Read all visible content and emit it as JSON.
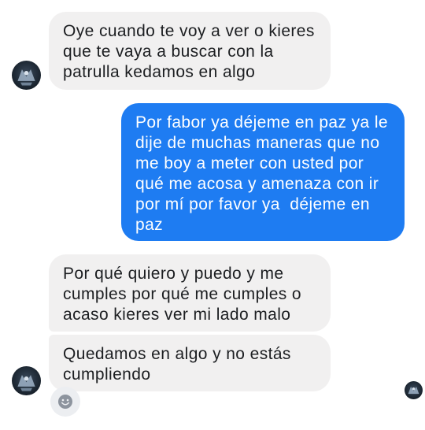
{
  "messages": [
    {
      "direction": "incoming",
      "text": "Oye cuando te voy a ver o kieres\nque te vaya a buscar con la\npatrulla kedamos en algo"
    },
    {
      "direction": "outgoing",
      "text": "Por fabor ya déjeme en paz ya le\ndije de muchas maneras que no\nme boy a meter con usted por\nqué me acosa y amenaza con ir\npor mí por favor ya  déjeme en\npaz"
    },
    {
      "direction": "incoming",
      "text": "Por qué quiero y puedo y me\ncumples por qué me cumples o\nacaso kieres ver mi lado malo"
    },
    {
      "direction": "incoming",
      "text": "Quedamos en algo y no estás\ncumpliendo"
    }
  ],
  "icons": {
    "contact_avatar": "avatar-icon",
    "read_receipt": "seen-avatar-icon",
    "reaction": "smiley-icon"
  },
  "colors": {
    "incoming_bubble": "#f1f0f0",
    "outgoing_bubble": "#1e7cf2",
    "incoming_text": "#1c1e21",
    "outgoing_text": "#ffffff",
    "background": "#ffffff"
  }
}
